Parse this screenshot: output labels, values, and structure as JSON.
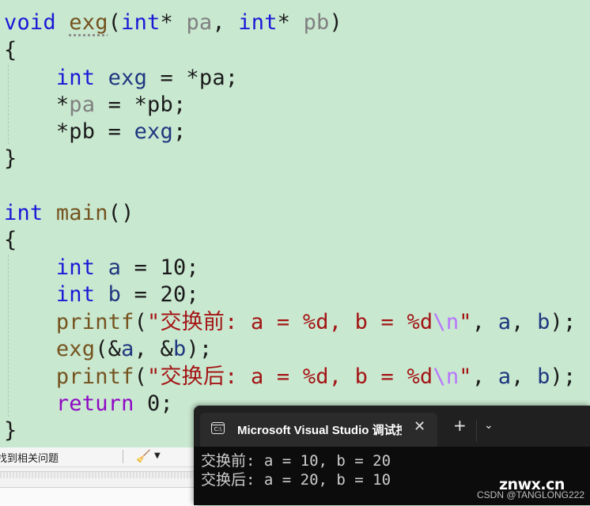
{
  "editor": {
    "code": {
      "l1": {
        "kw1": "void",
        "fn": "exg",
        "p1": "(",
        "kw2": "int",
        "p2": "* ",
        "param1": "pa",
        "p3": ", ",
        "kw3": "int",
        "p4": "* ",
        "param2": "pb",
        "p5": ")"
      },
      "l2": {
        "text": "{"
      },
      "l3": {
        "kw": "int",
        "local": "exg",
        "rest": " = *pa;"
      },
      "l4": {
        "star": "*",
        "param": "pa",
        "rest": " = *pb;"
      },
      "l5": {
        "star": "*pb = ",
        "local": "exg",
        "rest": ";"
      },
      "l6": {
        "text": "}"
      },
      "l7": {
        "kw": "int",
        "fn": "main",
        "rest": "()"
      },
      "l8": {
        "text": "{"
      },
      "l9": {
        "kw": "int",
        "local": "a",
        "rest": " = 10;"
      },
      "l10": {
        "kw": "int",
        "local": "b",
        "rest": " = 20;"
      },
      "l11": {
        "fn": "printf",
        "p1": "(",
        "str": "\"交换前: a = %d, b = %d",
        "esc": "\\n",
        "str2": "\"",
        "p2": ", ",
        "a": "a",
        "p3": ", ",
        "b": "b",
        "p4": ");"
      },
      "l12": {
        "fn": "exg",
        "p1": "(&",
        "a": "a",
        "p2": ", &",
        "b": "b",
        "p3": ");"
      },
      "l13": {
        "fn": "printf",
        "p1": "(",
        "str": "\"交换后: a = %d, b = %d",
        "esc": "\\n",
        "str2": "\"",
        "p2": ", ",
        "a": "a",
        "p3": ", ",
        "b": "b",
        "p4": ");"
      },
      "l14": {
        "kw": "return",
        "rest": " 0;"
      },
      "l15": {
        "text": "}"
      }
    },
    "colors": {
      "keyword": "#1a1ad6",
      "function": "#74531f",
      "parameter": "#808080",
      "local": "#1f377f",
      "string": "#a31515",
      "escape": "#b776fb",
      "control": "#8f08c4",
      "background": "#c9e8d0"
    }
  },
  "bottom_panel": {
    "search_label": "找到相关问题",
    "broom_icon": "🧹",
    "dropdown_icon": "▼"
  },
  "terminal": {
    "tab_icon_text": "C:\\",
    "tab_title": "Microsoft Visual Studio 调试控制台",
    "close_icon": "✕",
    "new_tab_icon": "+",
    "dropdown_icon": "⌄",
    "output": [
      "交换前: a = 10, b = 20",
      "交换后: a = 20, b = 10"
    ]
  },
  "watermark": {
    "site": "znwx.cn",
    "author": "CSDN @TANGLONG222"
  }
}
